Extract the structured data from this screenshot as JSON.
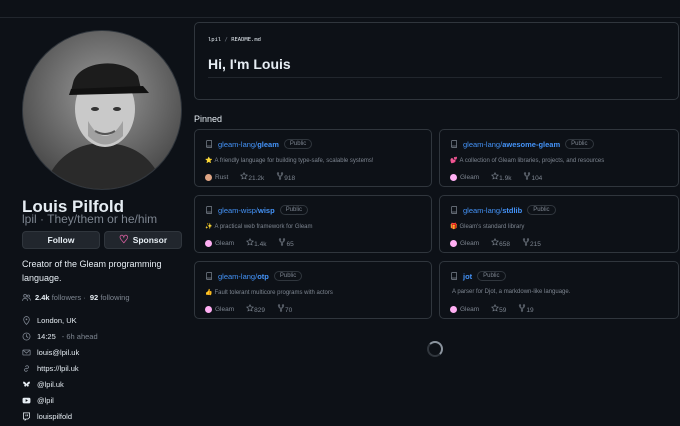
{
  "profile": {
    "name": "Louis Pilfold",
    "handle": "lpil · They/them or he/him",
    "follow_label": "Follow",
    "sponsor_label": "Sponsor",
    "bio": "Creator of the Gleam programming language.",
    "followers_count": "2.4k",
    "followers_label": "followers ·",
    "following_count": "92",
    "following_label": "following",
    "location": "London, UK",
    "time": "14:25",
    "time_note": "- 6h ahead",
    "email": "louis@lpil.uk",
    "website": "https://lpil.uk",
    "bluesky": "@lpil.uk",
    "youtube": "@lpil",
    "twitch": "louispilfold"
  },
  "readme": {
    "path_user": "lpil",
    "path_sep": " / ",
    "path_file": "README.md",
    "title": "Hi, I'm Louis"
  },
  "pinned": {
    "title": "Pinned",
    "repos": [
      {
        "owner": "gleam-lang/",
        "name": "gleam",
        "visibility": "Public",
        "emoji": "⭐",
        "description": "A friendly language for building type-safe, scalable systems!",
        "language": "Rust",
        "lang_color": "#dea584",
        "stars": "21.2k",
        "forks": "918"
      },
      {
        "owner": "gleam-lang/",
        "name": "awesome-gleam",
        "visibility": "Public",
        "emoji": "💕",
        "description": "A collection of Gleam libraries, projects, and resources",
        "language": "Gleam",
        "lang_color": "#ffaff3",
        "stars": "1.9k",
        "forks": "104"
      },
      {
        "owner": "gleam-wisp/",
        "name": "wisp",
        "visibility": "Public",
        "emoji": "✨",
        "description": "A practical web framework for Gleam",
        "language": "Gleam",
        "lang_color": "#ffaff3",
        "stars": "1.4k",
        "forks": "65"
      },
      {
        "owner": "gleam-lang/",
        "name": "stdlib",
        "visibility": "Public",
        "emoji": "🎁",
        "description": "Gleam's standard library",
        "language": "Gleam",
        "lang_color": "#ffaff3",
        "stars": "658",
        "forks": "215"
      },
      {
        "owner": "gleam-lang/",
        "name": "otp",
        "visibility": "Public",
        "emoji": "👍",
        "description": "Fault tolerant multicore programs with actors",
        "language": "Gleam",
        "lang_color": "#ffaff3",
        "stars": "829",
        "forks": "70"
      },
      {
        "owner": "",
        "name": "jot",
        "visibility": "Public",
        "emoji": "",
        "description": "A parser for Djot, a markdown-like language.",
        "language": "Gleam",
        "lang_color": "#ffaff3",
        "stars": "59",
        "forks": "19"
      }
    ]
  },
  "colors": {
    "accent": "#4493f8",
    "background": "#0d1117",
    "border": "#30363d",
    "muted": "#7d8590",
    "sponsor": "#db61a2"
  },
  "icons": [
    "repo-icon",
    "star-icon",
    "fork-icon",
    "people-icon",
    "location-icon",
    "clock-icon",
    "mail-icon",
    "link-icon",
    "bluesky-icon",
    "youtube-icon",
    "twitch-icon",
    "heart-icon",
    "loading-spinner"
  ]
}
